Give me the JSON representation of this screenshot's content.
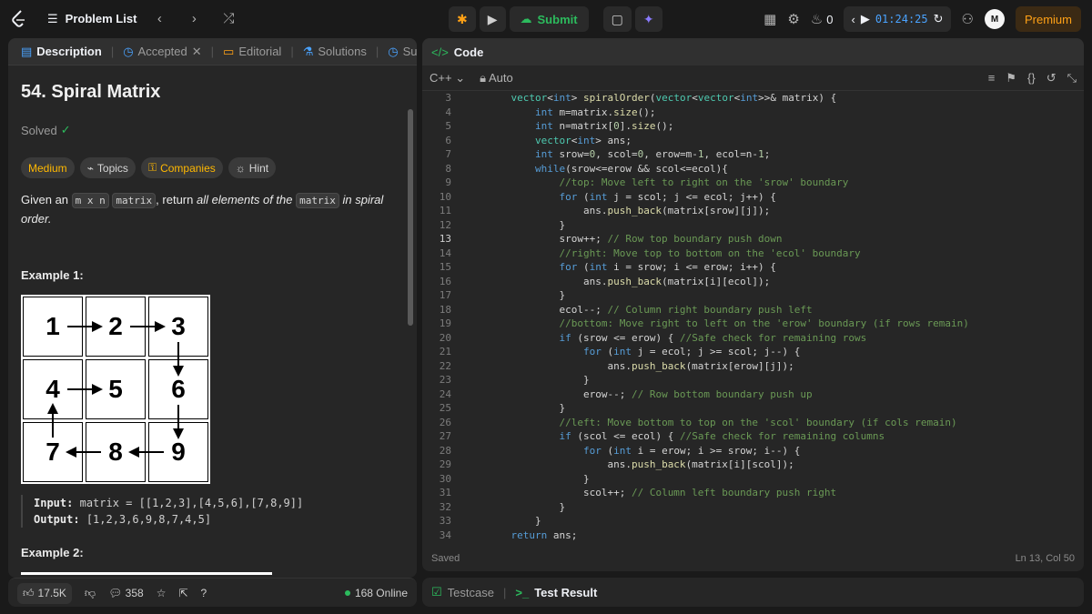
{
  "topbar": {
    "problem_list": "Problem List",
    "submit": "Submit",
    "streak": "0",
    "timer": "01:24:25",
    "premium": "Premium"
  },
  "left": {
    "tabs": [
      "Description",
      "Accepted",
      "Editorial",
      "Solutions",
      "Submission"
    ],
    "title": "54. Spiral Matrix",
    "solved": "Solved",
    "chips": [
      "Medium",
      "Topics",
      "Companies",
      "Hint"
    ],
    "statement": {
      "pre": "Given an",
      "code1": "m x n",
      "code2": "matrix",
      "mid": ", return",
      "emph": "all elements of the",
      "code3": "matrix",
      "post": "in spiral order."
    },
    "example1": "Example 1:",
    "grid": [
      "1",
      "2",
      "3",
      "4",
      "5",
      "6",
      "7",
      "8",
      "9"
    ],
    "input_label": "Input:",
    "input_val": "matrix = [[1,2,3],[4,5,6],[7,8,9]]",
    "output_label": "Output:",
    "output_val": "[1,2,3,6,9,8,7,4,5]",
    "example2": "Example 2:",
    "footer": {
      "likes": "17.5K",
      "comments": "358",
      "online": "168 Online"
    }
  },
  "code": {
    "header": "Code",
    "lang": "C++",
    "mode": "Auto",
    "lines": [
      {
        "n": "3",
        "t": "    vector<int> spiralOrder(vector<vector<int>>& matrix) {"
      },
      {
        "n": "4",
        "t": "        int m=matrix.size();"
      },
      {
        "n": "5",
        "t": "        int n=matrix[0].size();"
      },
      {
        "n": "6",
        "t": "        vector<int> ans;"
      },
      {
        "n": "7",
        "t": "        int srow=0, scol=0, erow=m-1, ecol=n-1;"
      },
      {
        "n": "8",
        "t": "        while(srow<=erow && scol<=ecol){"
      },
      {
        "n": "9",
        "t": "            //top: Move left to right on the 'srow' boundary"
      },
      {
        "n": "10",
        "t": "            for (int j = scol; j <= ecol; j++) {"
      },
      {
        "n": "11",
        "t": "                ans.push_back(matrix[srow][j]);"
      },
      {
        "n": "12",
        "t": "            }"
      },
      {
        "n": "13",
        "t": "            srow++; // Row top boundary push down"
      },
      {
        "n": "14",
        "t": "            //right: Move top to bottom on the 'ecol' boundary"
      },
      {
        "n": "15",
        "t": "            for (int i = srow; i <= erow; i++) {"
      },
      {
        "n": "16",
        "t": "                ans.push_back(matrix[i][ecol]);"
      },
      {
        "n": "17",
        "t": "            }"
      },
      {
        "n": "18",
        "t": "            ecol--; // Column right boundary push left"
      },
      {
        "n": "19",
        "t": "            //bottom: Move right to left on the 'erow' boundary (if rows remain)"
      },
      {
        "n": "20",
        "t": "            if (srow <= erow) { //Safe check for remaining rows"
      },
      {
        "n": "21",
        "t": "                for (int j = ecol; j >= scol; j--) {"
      },
      {
        "n": "22",
        "t": "                    ans.push_back(matrix[erow][j]);"
      },
      {
        "n": "23",
        "t": "                }"
      },
      {
        "n": "24",
        "t": "                erow--; // Row bottom boundary push up"
      },
      {
        "n": "25",
        "t": "            }"
      },
      {
        "n": "26",
        "t": "            //left: Move bottom to top on the 'scol' boundary (if cols remain)"
      },
      {
        "n": "27",
        "t": "            if (scol <= ecol) { //Safe check for remaining columns"
      },
      {
        "n": "28",
        "t": "                for (int i = erow; i >= srow; i--) {"
      },
      {
        "n": "29",
        "t": "                    ans.push_back(matrix[i][scol]);"
      },
      {
        "n": "30",
        "t": "                }"
      },
      {
        "n": "31",
        "t": "                scol++; // Column left boundary push right"
      },
      {
        "n": "32",
        "t": "            }"
      },
      {
        "n": "33",
        "t": "        }"
      },
      {
        "n": "34",
        "t": "    return ans;"
      }
    ],
    "saved": "Saved",
    "position": "Ln 13, Col 50"
  },
  "bottom": {
    "testcase": "Testcase",
    "test_result": "Test Result"
  }
}
